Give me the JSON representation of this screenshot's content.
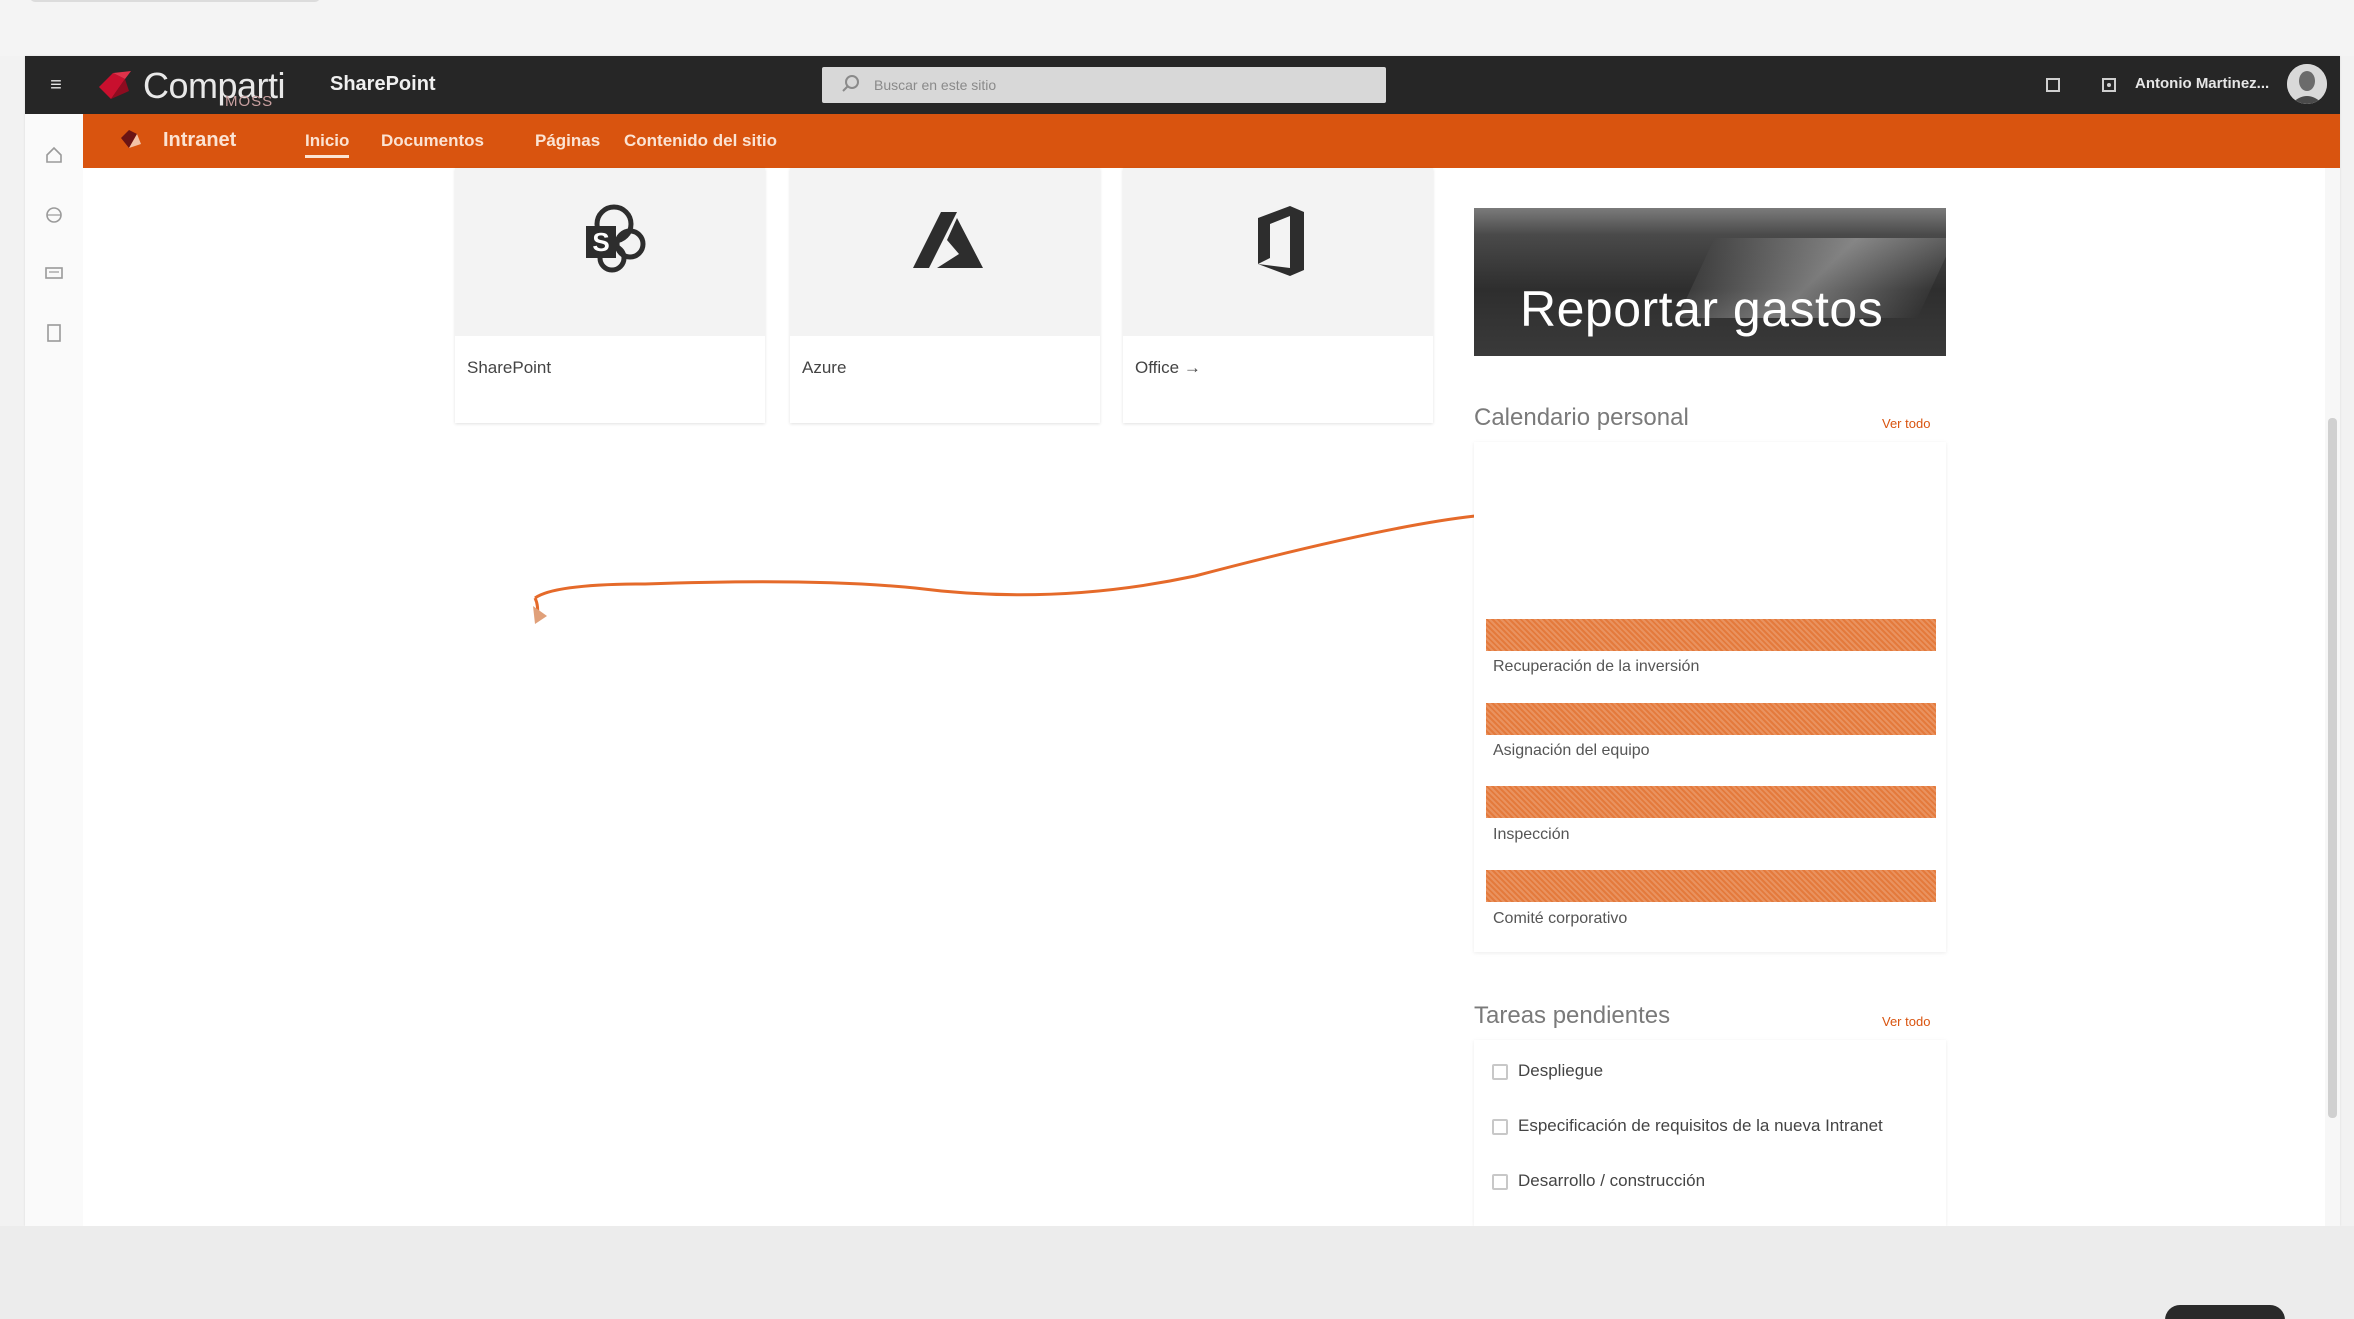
{
  "suite_bar": {
    "logo_text": "Comparti",
    "logo_subtext": "MOSS",
    "app_name": "SharePoint",
    "search_placeholder": "Buscar en este sitio",
    "user_name": "Antonio Martinez..."
  },
  "hub_nav": {
    "site_title": "Intranet",
    "links": [
      "Inicio",
      "Documentos",
      "Páginas",
      "Contenido del sitio"
    ]
  },
  "app_tiles": [
    {
      "label": "SharePoint",
      "icon": "sharepoint-icon"
    },
    {
      "label": "Azure",
      "icon": "azure-icon"
    },
    {
      "label": "Office →",
      "icon": "office-icon"
    }
  ],
  "banner": {
    "text": "Reportar gastos"
  },
  "calendar": {
    "title": "Calendario personal",
    "see_all": "Ver todo",
    "events": [
      {
        "date": "",
        "title": "Recuperación de la inversión"
      },
      {
        "date": "",
        "title": "Asignación del equipo"
      },
      {
        "date": "",
        "title": "Inspección"
      },
      {
        "date": "",
        "title": "Comité corporativo"
      }
    ]
  },
  "tasks": {
    "title": "Tareas pendientes",
    "see_all": "Ver todo",
    "items": [
      {
        "title": "Despliegue",
        "meta": ""
      },
      {
        "title": "Especificación de requisitos de la nueva Intranet",
        "meta": ""
      },
      {
        "title": "Desarrollo / construcción",
        "meta": ""
      }
    ]
  },
  "colors": {
    "suite_bar": "#262626",
    "accent_orange": "#d9540f",
    "event_orange": "#e47a3c"
  },
  "icons": {
    "rail": [
      "home-icon",
      "globe-icon",
      "news-icon",
      "files-icon"
    ],
    "suite": [
      "notifications-icon",
      "settings-icon"
    ]
  }
}
